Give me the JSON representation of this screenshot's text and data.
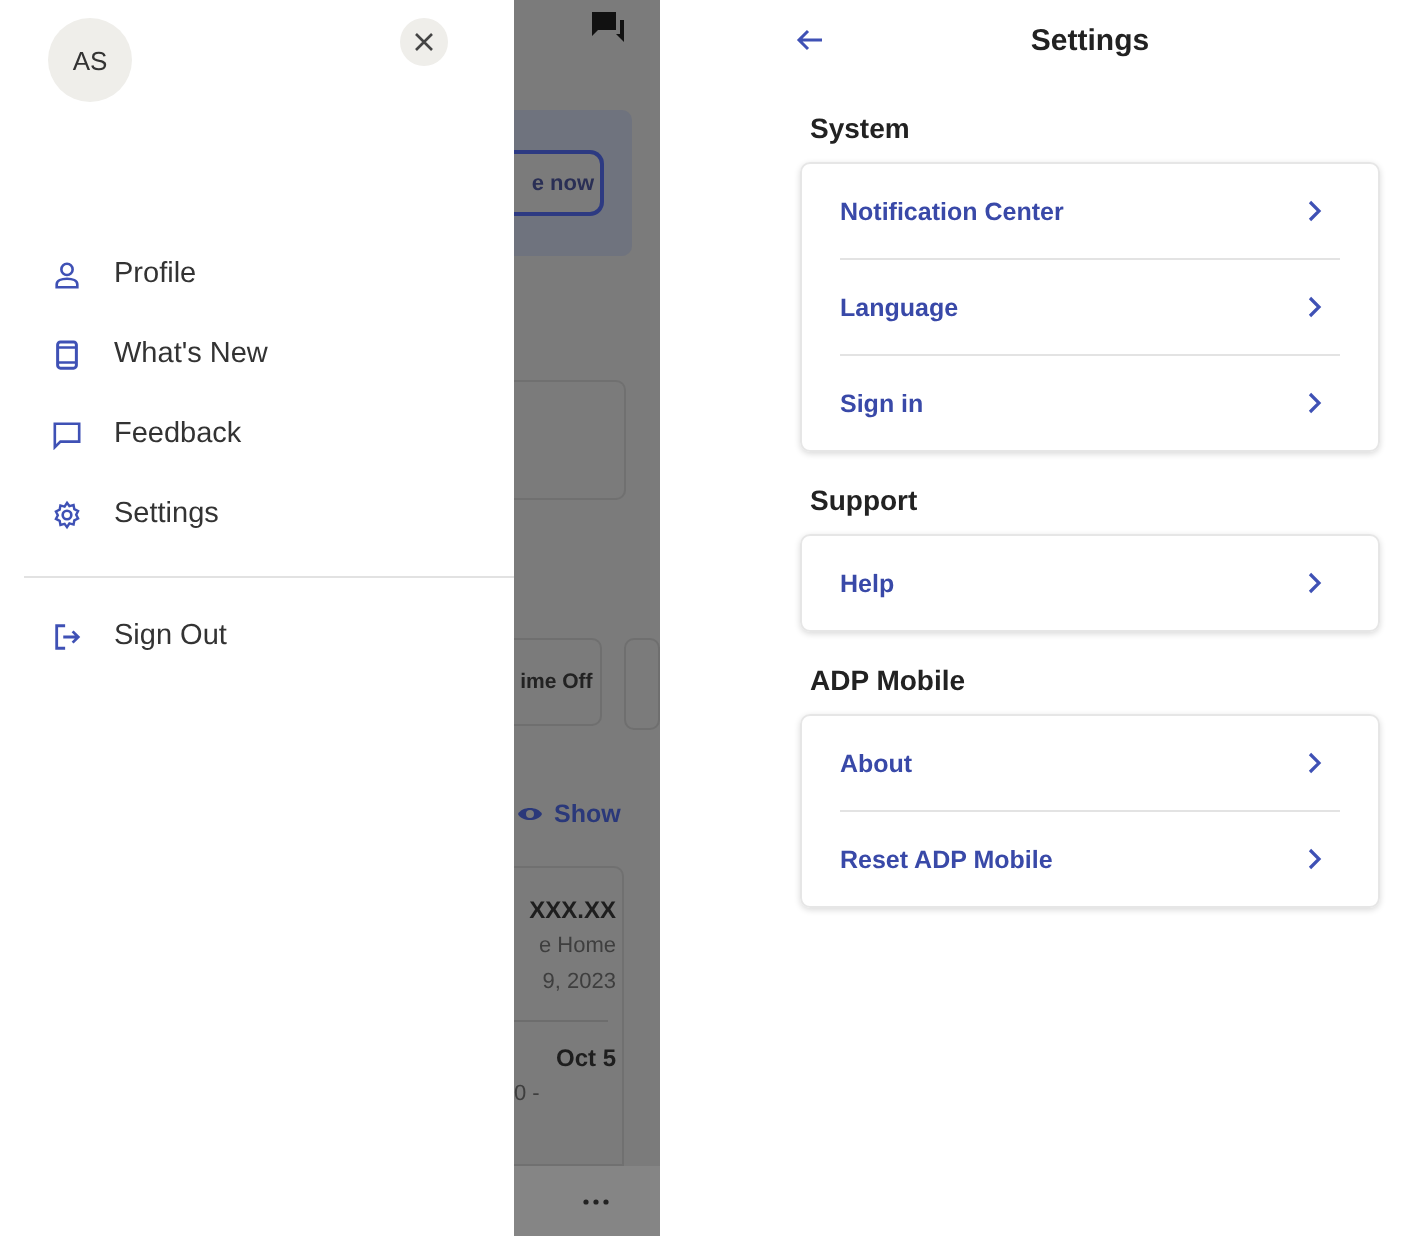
{
  "drawer": {
    "avatar": "AS",
    "items": [
      {
        "label": "Profile",
        "kind": "person"
      },
      {
        "label": "What's New",
        "kind": "phone"
      },
      {
        "label": "Feedback",
        "kind": "chat"
      },
      {
        "label": "Settings",
        "kind": "gear"
      }
    ],
    "footer_items": [
      {
        "label": "Sign Out",
        "kind": "signout"
      }
    ]
  },
  "background_screen": {
    "banner_button": "e now",
    "time_off_button": "ime Off",
    "show_link": "Show",
    "pay_card": {
      "amount": "XXX.XX",
      "line_2": "e Home",
      "date": "9, 2023",
      "next_date": "Oct 5",
      "line_5": "0 -"
    }
  },
  "settings": {
    "title": "Settings",
    "sections": [
      {
        "heading": "System",
        "items": [
          "Notification Center",
          "Language",
          "Sign in"
        ]
      },
      {
        "heading": "Support",
        "items": [
          "Help"
        ]
      },
      {
        "heading": "ADP Mobile",
        "items": [
          "About",
          "Reset ADP Mobile"
        ]
      }
    ]
  }
}
